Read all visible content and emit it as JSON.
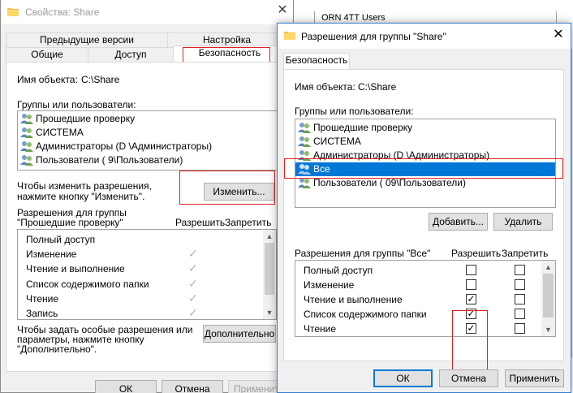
{
  "background_window": {
    "title": "Свойства: Share",
    "close_glyph": "✕",
    "tabs_row1": [
      "Предыдущие версии",
      "Настройка"
    ],
    "tabs_row2": [
      "Общие",
      "Доступ",
      "Безопасность"
    ],
    "object_label": "Имя объекта:",
    "object_value": "C:\\Share",
    "groups_label": "Группы или пользователи:",
    "users": [
      "Прошедшие проверку",
      "СИСТЕМА",
      "Администраторы (D               \\Администраторы)",
      "Пользователи (               9\\Пользователи)"
    ],
    "change_hint_1": "Чтобы изменить разрешения,",
    "change_hint_2": "нажмите кнопку \"Изменить\".",
    "change_button": "Изменить...",
    "perm_label_1": "Разрешения для группы",
    "perm_label_2": "\"Прошедшие проверку\"",
    "allow_header": "Разрешить",
    "deny_header": "Запретить",
    "permissions": [
      "Полный доступ",
      "Изменение",
      "Чтение и выполнение",
      "Список содержимого папки",
      "Чтение",
      "Запись"
    ],
    "allowed_check_glyph": "✓",
    "advanced_hint_1": "Чтобы задать особые разрешения или",
    "advanced_hint_2": "параметры, нажмите кнопку",
    "advanced_hint_3": "\"Дополнительно\".",
    "advanced_button": "Дополнительно",
    "ok_button": "ОК",
    "cancel_button": "Отмена",
    "apply_button": "Применить"
  },
  "far_right": {
    "text": "ORN 4TT Users"
  },
  "foreground_dialog": {
    "title": "Разрешения для группы \"Share\"",
    "close_glyph": "✕",
    "tab": "Безопасность",
    "object_label": "Имя объекта:",
    "object_value": "C:\\Share",
    "groups_label": "Группы или пользователи:",
    "users": [
      "Прошедшие проверку",
      "СИСТЕМА",
      "Администраторы (D               \\Администраторы)",
      "Все",
      "Пользователи (               09\\Пользователи)"
    ],
    "selected_user_index": 3,
    "add_button": "Добавить...",
    "remove_button": "Удалить",
    "perm_label": "Разрешения для группы \"Все\"",
    "allow_header": "Разрешить",
    "deny_header": "Запретить",
    "permissions": [
      {
        "name": "Полный доступ",
        "allow": false,
        "deny": false
      },
      {
        "name": "Изменение",
        "allow": false,
        "deny": false
      },
      {
        "name": "Чтение и выполнение",
        "allow": true,
        "deny": false
      },
      {
        "name": "Список содержимого папки",
        "allow": true,
        "deny": false
      },
      {
        "name": "Чтение",
        "allow": true,
        "deny": false
      }
    ],
    "check_glyph": "✓",
    "ok_button": "ОК",
    "cancel_button": "Отмена",
    "apply_button": "Применить"
  },
  "colors": {
    "selection": "#0078d7",
    "highlight_box": "#e02020",
    "dialog_bg": "#f0f0f0"
  }
}
